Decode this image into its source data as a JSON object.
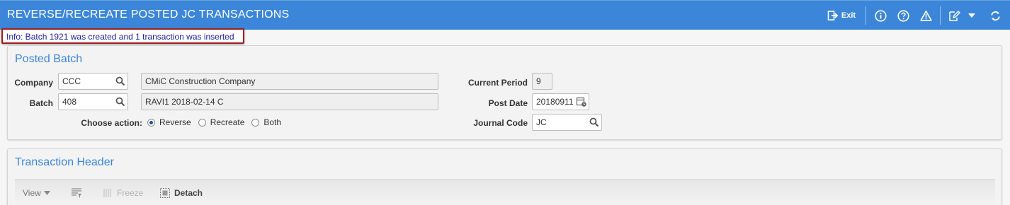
{
  "window": {
    "title": "REVERSE/RECREATE POSTED JC TRANSACTIONS"
  },
  "titlebar": {
    "exit_label": "Exit",
    "icons": [
      "exit-icon",
      "info-icon",
      "help-icon",
      "warning-icon",
      "edit-icon",
      "chevron-down-icon",
      "refresh-icon"
    ]
  },
  "message": {
    "text": "Info: Batch 1921 was created and 1 transaction was inserted"
  },
  "posted_batch": {
    "title": "Posted Batch",
    "company": {
      "label": "Company",
      "code": "CCC",
      "name": "CMiC Construction Company"
    },
    "batch": {
      "label": "Batch",
      "code": "408",
      "description": "RAVI1 2018-02-14 C"
    },
    "choose_action": {
      "label": "Choose action:",
      "options": [
        "Reverse",
        "Recreate",
        "Both"
      ],
      "selected": "Reverse"
    },
    "current_period": {
      "label": "Current Period",
      "value": "9"
    },
    "post_date": {
      "label": "Post Date",
      "value": "20180911"
    },
    "journal_code": {
      "label": "Journal Code",
      "value": "JC"
    }
  },
  "transaction_header": {
    "title": "Transaction Header",
    "toolbar": {
      "view_label": "View",
      "freeze_label": "Freeze",
      "detach_label": "Detach"
    }
  },
  "colors": {
    "titlebar": "#3b86d8",
    "accent": "#3b86d8",
    "message_border": "#a31d1d",
    "message_text": "#1d1d9e"
  }
}
